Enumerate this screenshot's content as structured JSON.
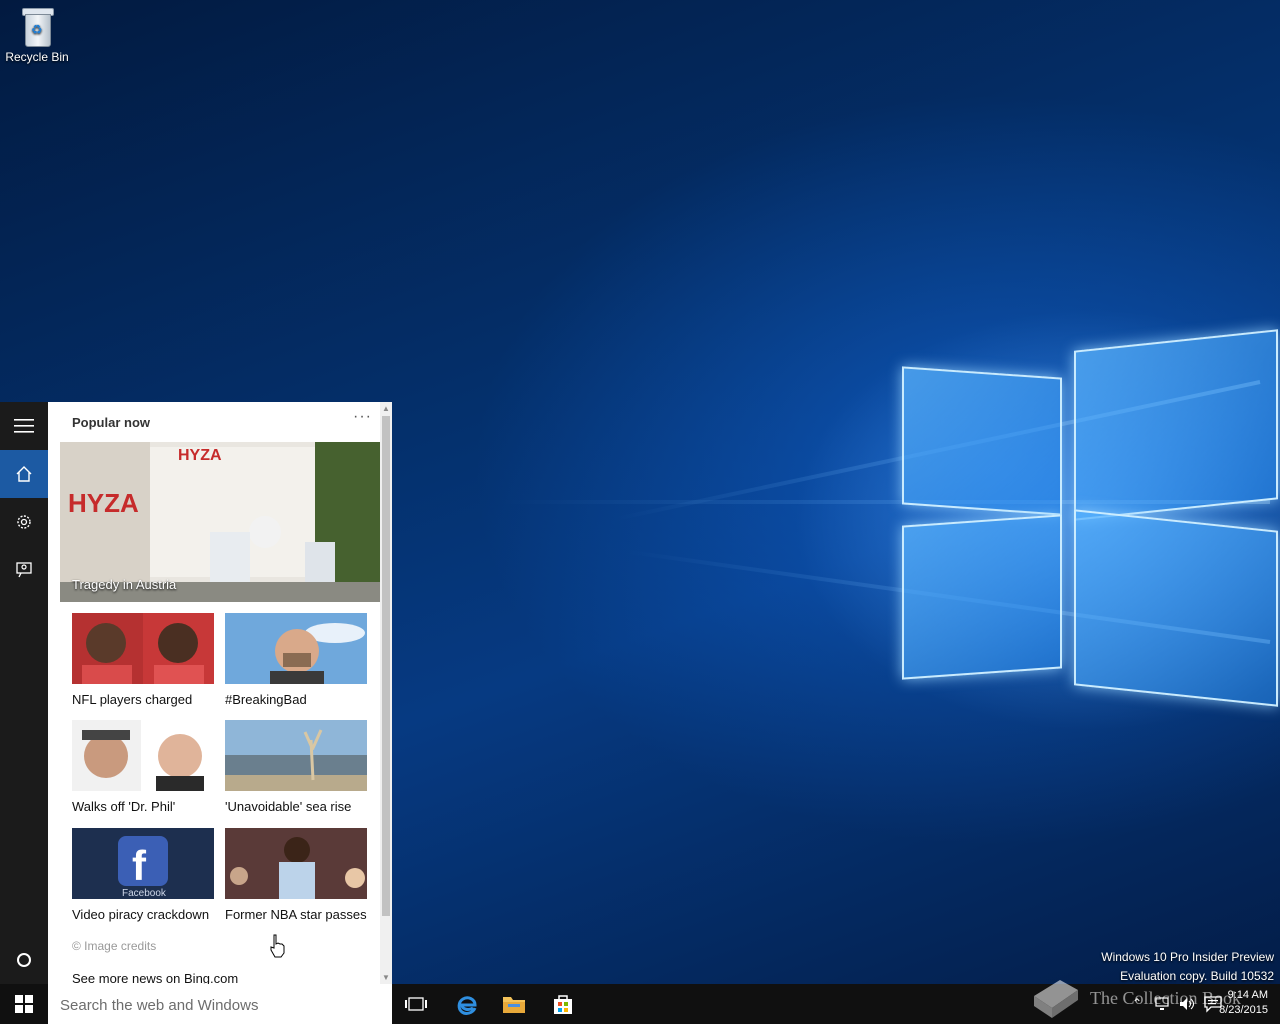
{
  "desktop": {
    "recycle_bin_label": "Recycle Bin",
    "watermark_line1": "Windows 10 Pro Insider Preview",
    "watermark_line2": "Evaluation copy. Build 10532"
  },
  "cortana": {
    "popular_title": "Popular now",
    "more_label": "···",
    "hero_caption": "Tragedy in Austria",
    "tiles": [
      {
        "caption": "NFL players charged"
      },
      {
        "caption": "#BreakingBad"
      },
      {
        "caption": "Walks off 'Dr. Phil'"
      },
      {
        "caption": "'Unavoidable' sea rise"
      },
      {
        "caption": "Video piracy crackdown"
      },
      {
        "caption": "Former NBA star passes"
      }
    ],
    "image_credits": "© Image credits",
    "see_more": "See more news on Bing.com",
    "hero_truck_text": "HYZA",
    "facebook_text": "Facebook"
  },
  "taskbar": {
    "search_placeholder": "Search the web and Windows",
    "time": "9:14 AM",
    "date": "8/23/2015"
  },
  "overlay": {
    "logo_text": "The Collection Book"
  },
  "colors": {
    "accent": "#1c5aa3",
    "rail_bg": "#1b1b1b",
    "taskbar_bg": "#101010"
  }
}
